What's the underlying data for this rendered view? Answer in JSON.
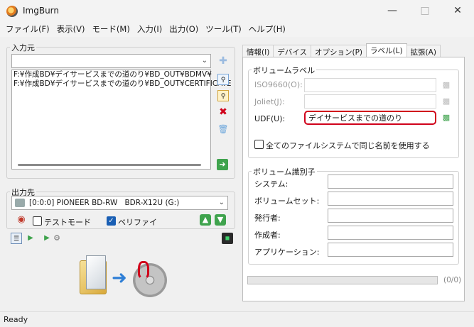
{
  "window": {
    "title": "ImgBurn"
  },
  "menu": [
    "ファイル(F)",
    "表示(V)",
    "モード(M)",
    "入力(I)",
    "出力(O)",
    "ツール(T)",
    "ヘルプ(H)"
  ],
  "source": {
    "label": "入力元",
    "combo_value": "",
    "files": [
      "F:¥作成BD¥デイサービスまでの道のり¥BD_OUT¥BDMV¥",
      "F:¥作成BD¥デイサービスまでの道のり¥BD_OUT¥CERTIFICATE"
    ]
  },
  "destination": {
    "label": "出力先",
    "drive": "[0:0:0] PIONEER BD-RW   BDR-X12U (G:)",
    "test_mode_label": "テストモード",
    "test_mode_checked": false,
    "verify_label": "ベリファイ",
    "verify_checked": true
  },
  "tabs": [
    "情報(I)",
    "デバイス",
    "オプション(P)",
    "ラベル(L)",
    "拡張(A)"
  ],
  "active_tab": "ラベル(L)",
  "volume_label": {
    "group": "ボリュームラベル",
    "iso_label": "ISO9660(O):",
    "joliet_label": "Joliet(J):",
    "udf_label": "UDF(U):",
    "iso_value": "",
    "joliet_value": "",
    "udf_value": "デイサービスまでの道のり",
    "same_name_label": "全てのファイルシステムで同じ名前を使用する",
    "same_name_checked": false
  },
  "volume_id": {
    "group": "ボリューム識別子",
    "fields": [
      "システム:",
      "ボリュームセット:",
      "発行者:",
      "作成者:",
      "アプリケーション:"
    ]
  },
  "progress": {
    "text": "(0/0)",
    "fraction": 0
  },
  "status": "Ready",
  "colors": {
    "highlight": "#d0021b",
    "accent": "#1a5fb4"
  }
}
